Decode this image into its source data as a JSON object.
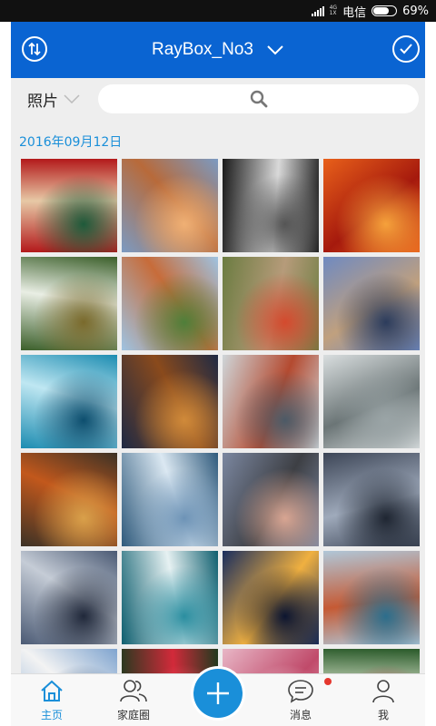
{
  "status_bar": {
    "network_top": "4G",
    "network_bottom": "1X",
    "carrier": "电信",
    "battery_percent": "69%",
    "battery_level": 0.69
  },
  "app_bar": {
    "left_icon": "sort-icon",
    "title": "RayBox_No3",
    "title_icon": "chevron-down-icon",
    "right_icon": "check-circle-icon"
  },
  "filter": {
    "label": "照片",
    "icon": "chevron-down-icon"
  },
  "search": {
    "icon": "search-icon"
  },
  "section": {
    "date": "2016年09月12日"
  },
  "photos": [
    {
      "subject": "pagoda-roof",
      "colors": [
        "#b3191b",
        "#e7c9a6",
        "#1e5a3a"
      ]
    },
    {
      "subject": "desert-rock-formation",
      "colors": [
        "#7b9ac2",
        "#b86a3a",
        "#f0b074"
      ]
    },
    {
      "subject": "white-architecture-abstract",
      "colors": [
        "#1a1a1a",
        "#d9d9d9",
        "#555555"
      ]
    },
    {
      "subject": "red-canyon-waves",
      "colors": [
        "#e8601a",
        "#a5190d",
        "#f5a13b"
      ]
    },
    {
      "subject": "forest-waterfall",
      "colors": [
        "#3b5f2a",
        "#e9eee4",
        "#7a6a2c"
      ]
    },
    {
      "subject": "old-town-towers",
      "colors": [
        "#9ec3e2",
        "#c76c3a",
        "#4f7f3a"
      ]
    },
    {
      "subject": "ivy-covered-alley",
      "colors": [
        "#6b7c41",
        "#b69b7a",
        "#d44a2e"
      ]
    },
    {
      "subject": "canal-houses-bridge",
      "colors": [
        "#6f8ac1",
        "#c0a07e",
        "#2c3c5c"
      ]
    },
    {
      "subject": "ocean-wave",
      "colors": [
        "#1c8cb1",
        "#bfe7f2",
        "#0d4e6e"
      ]
    },
    {
      "subject": "tea-and-cinnamon",
      "colors": [
        "#1f2a44",
        "#8a4a1c",
        "#d08a3a"
      ]
    },
    {
      "subject": "modern-waterfront-building",
      "colors": [
        "#cfd6d9",
        "#b44a30",
        "#4c5a66"
      ]
    },
    {
      "subject": "foggy-bridge-tower",
      "colors": [
        "#d9dedf",
        "#6b7576",
        "#9aa4a6"
      ]
    },
    {
      "subject": "autumn-leaves-on-water",
      "colors": [
        "#3c3226",
        "#c2581c",
        "#d9a04a"
      ]
    },
    {
      "subject": "frost-crystals",
      "colors": [
        "#2f5a7c",
        "#dbe8f2",
        "#6d93b6"
      ]
    },
    {
      "subject": "sea-pier-posts-sunset",
      "colors": [
        "#7b87a0",
        "#3d3f44",
        "#d8a592"
      ]
    },
    {
      "subject": "dramatic-clouds",
      "colors": [
        "#3d4657",
        "#9faabb",
        "#1f2632"
      ]
    },
    {
      "subject": "stormy-sky",
      "colors": [
        "#4b5a74",
        "#c5ccd6",
        "#20283a"
      ]
    },
    {
      "subject": "aerial-coast-waves",
      "colors": [
        "#0f5f6f",
        "#e6f1f2",
        "#2a8ea0"
      ]
    },
    {
      "subject": "island-abbey-night",
      "colors": [
        "#1a2e5e",
        "#f0b040",
        "#0c1530"
      ]
    },
    {
      "subject": "red-sea-cliffs",
      "colors": [
        "#b0c7d8",
        "#c55a34",
        "#2c6e8c"
      ]
    },
    {
      "subject": "white-roof-architecture",
      "colors": [
        "#7fa4cf",
        "#f3f3f3",
        "#2d4f7a"
      ]
    },
    {
      "subject": "red-roses",
      "colors": [
        "#1f3a1e",
        "#d22a3a",
        "#f06070"
      ]
    },
    {
      "subject": "pink-peonies",
      "colors": [
        "#e8b6c6",
        "#c04a6a",
        "#f4e0e6"
      ]
    },
    {
      "subject": "green-foliage-flowers",
      "colors": [
        "#2a5a2a",
        "#d6e2c8",
        "#c03048"
      ]
    }
  ],
  "bottom_nav": {
    "items": [
      {
        "label": "主页",
        "icon": "home-icon",
        "active": true
      },
      {
        "label": "家庭圈",
        "icon": "family-icon",
        "active": false
      },
      {
        "label": "消息",
        "icon": "message-icon",
        "active": false,
        "has_badge": true
      },
      {
        "label": "我",
        "icon": "person-icon",
        "active": false
      }
    ],
    "fab_icon": "plus-icon"
  },
  "colors": {
    "primary": "#0a64d2",
    "accent": "#1a8fd9",
    "badge": "#e5372e"
  }
}
